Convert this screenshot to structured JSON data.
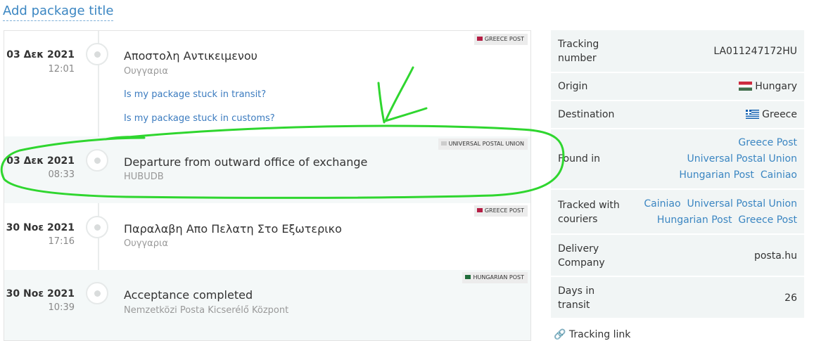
{
  "page": {
    "title": "Add package title"
  },
  "events": [
    {
      "date": "03 Δεκ 2021",
      "time": "12:01",
      "title": "Αποστολη Αντικειμενου",
      "location": "Ουγγαρια",
      "carrier": "GREECE POST",
      "carrier_color": "#b51e45",
      "links": [
        "Is my package stuck in transit?",
        "Is my package stuck in customs?"
      ]
    },
    {
      "date": "03 Δεκ 2021",
      "time": "08:33",
      "title": "Departure from outward office of exchange",
      "location": "HUBUDB",
      "carrier": "UNIVERSAL POSTAL UNION",
      "carrier_color": "#cccccc"
    },
    {
      "date": "30 Νοε 2021",
      "time": "17:16",
      "title": "Παραλαβη Απο Πελατη Στο Εξωτερικο",
      "location": "Ουγγαρια",
      "carrier": "GREECE POST",
      "carrier_color": "#b51e45"
    },
    {
      "date": "30 Νοε 2021",
      "time": "10:39",
      "title": "Acceptance completed",
      "location": "Nemzetközi Posta Kicserélő Központ",
      "carrier": "HUNGARIAN POST",
      "carrier_color": "#1f6b3a"
    }
  ],
  "info": {
    "tracking_number_label": "Tracking number",
    "tracking_number": "LA011247172HU",
    "origin_label": "Origin",
    "origin": "Hungary",
    "destination_label": "Destination",
    "destination": "Greece",
    "found_in_label": "Found in",
    "found_in": [
      "Greece Post",
      "Universal Postal Union",
      "Hungarian Post",
      "Cainiao"
    ],
    "tracked_with_label": "Tracked with couriers",
    "tracked_with": [
      "Cainiao",
      "Universal Postal Union",
      "Hungarian Post",
      "Greece Post"
    ],
    "delivery_company_label": "Delivery Company",
    "delivery_company": "posta.hu",
    "days_in_transit_label": "Days in transit",
    "days_in_transit": "26",
    "tracking_link_label": "Tracking link"
  },
  "annotation_color": "#2fd62f"
}
